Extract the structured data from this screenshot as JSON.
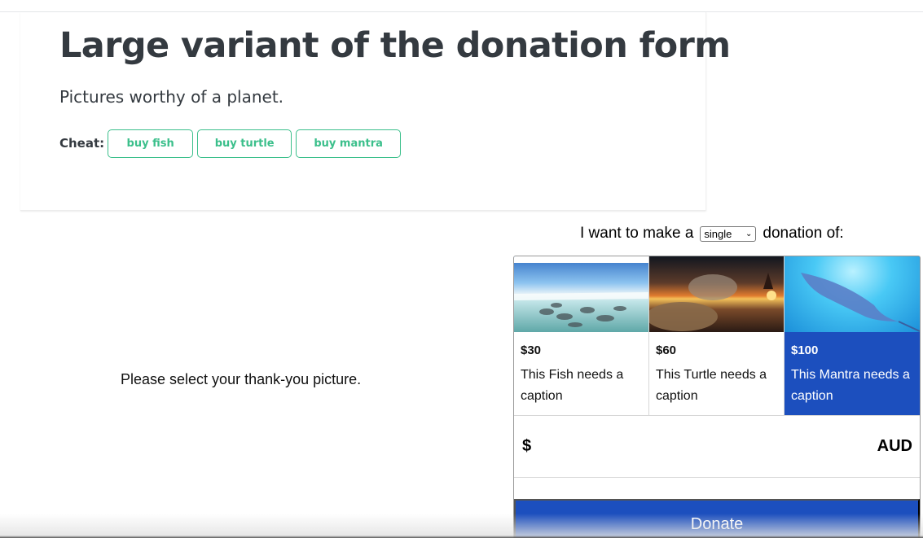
{
  "jumbotron": {
    "title": "Large variant of the donation form",
    "lead": "Pictures worthy of a planet.",
    "cheat_label": "Cheat:",
    "cheat_buttons": [
      "buy fish",
      "buy turtle",
      "buy mantra"
    ]
  },
  "donation": {
    "intro_prefix": "I want to make a",
    "frequency_selected": "single",
    "intro_suffix": "donation of:",
    "select_prompt": "Please select your thank-you picture.",
    "tiles": [
      {
        "price": "$30",
        "caption": "This Fish needs a caption",
        "selected": false
      },
      {
        "price": "$60",
        "caption": "This Turtle needs a caption",
        "selected": false
      },
      {
        "price": "$100",
        "caption": "This Mantra needs a caption",
        "selected": true
      }
    ],
    "currency_symbol": "$",
    "currency_code": "AUD",
    "donate_label": "Donate"
  },
  "colors": {
    "accent_green": "#3bbf8b",
    "primary_blue": "#1c4fbe",
    "text_dark": "#343a40"
  }
}
